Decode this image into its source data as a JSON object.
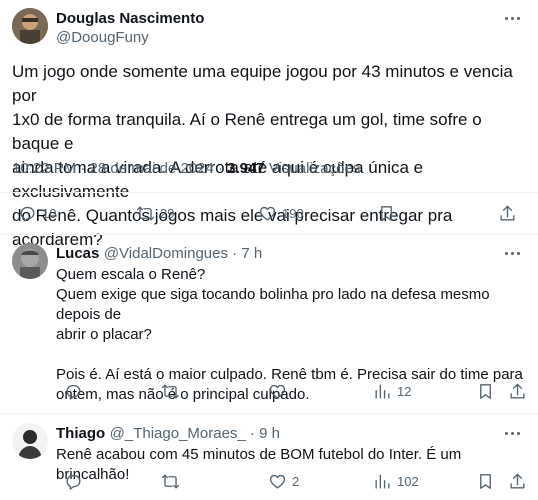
{
  "main_tweet": {
    "author_name": "Douglas Nascimento",
    "author_handle": "@DoougFuny",
    "lines": [
      "Um jogo onde somente uma equipe jogou por 43 minutos e vencia por",
      "1x0 de forma tranquila. Aí o Renê entrega um gol, time sofre o baque e",
      "ainda toma a virada. A derrota até aqui é culpa única e exclusivamente",
      "do Renê. Quantos jogos mais ele vai precisar entregar pra acordarem?"
    ],
    "time": "10:22 PM · 28 de mai de 2024 · ",
    "views_count": "3.947",
    "views_label": " Visualizações",
    "replies": "10",
    "retweets": "29",
    "likes": "190"
  },
  "replies": [
    {
      "author_name": "Lucas",
      "author_handle": "@VidalDomingues · 7 h",
      "lines": [
        "Quem escala o Renê?",
        "Quem exige que siga tocando bolinha pro lado na defesa mesmo depois de",
        "abrir o placar?",
        "",
        "Pois é. Aí está o maior culpado. Renê tbm é. Precisa sair do time para",
        "ontem, mas não é o principal culpado."
      ],
      "views": "12"
    },
    {
      "author_name": "Thiago",
      "author_handle": "@_Thiago_Moraes_ · 9 h",
      "lines": [
        "Renê acabou com 45 minutos de BOM futebol do Inter. É um brincalhão!"
      ],
      "likes": "2",
      "views": "102"
    }
  ],
  "icons": {
    "reply": "reply-icon",
    "retweet": "retweet-icon",
    "like": "heart-icon",
    "views": "views-icon",
    "bookmark": "bookmark-icon",
    "share": "share-icon",
    "more": "more-icon"
  }
}
